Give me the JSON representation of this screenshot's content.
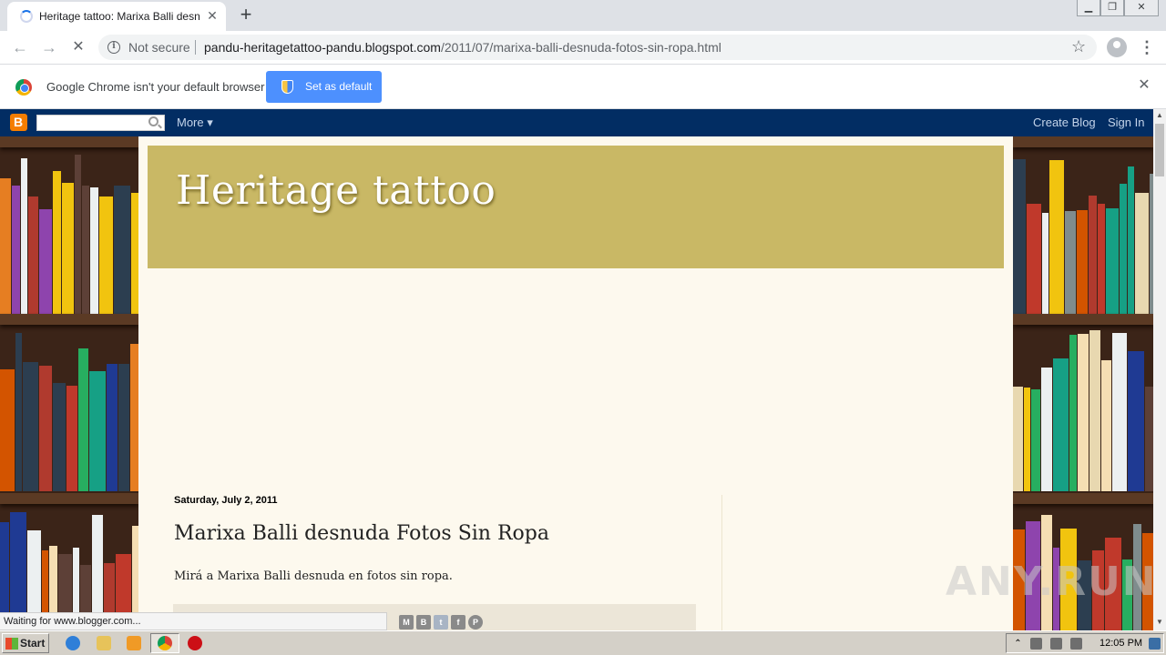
{
  "browser": {
    "tab": {
      "title": "Heritage tattoo: Marixa Balli desnuda Fotos Sin Ropa"
    },
    "new_tab_glyph": "+",
    "tab_close_glyph": "✕",
    "nav": {
      "back": "←",
      "forward": "→",
      "reload": "✕"
    },
    "address": {
      "security_label": "Not secure",
      "host": "pandu-heritagetattoo-pandu.blogspot.com",
      "path": "/2011/07/marixa-balli-desnuda-fotos-sin-ropa.html"
    },
    "star_glyph": "☆",
    "menu_glyph": "⋮",
    "infobar": {
      "message": "Google Chrome isn't your default browser",
      "button": "Set as default",
      "close_glyph": "✕"
    },
    "status_bubble": "Waiting for www.blogger.com..."
  },
  "blogger_bar": {
    "more_label": "More ▾",
    "create_blog": "Create Blog",
    "sign_in": "Sign In"
  },
  "blog": {
    "title": "Heritage tattoo",
    "post": {
      "date": "Saturday, July 2, 2011",
      "title": "Marixa Balli desnuda Fotos Sin Ropa",
      "body": "Mirá a Marixa Balli desnuda en fotos sin ropa."
    },
    "share_buttons": [
      {
        "icon": "email-icon",
        "glyph": "M"
      },
      {
        "icon": "blogthis-icon",
        "glyph": "B"
      },
      {
        "icon": "twitter-icon",
        "glyph": "t"
      },
      {
        "icon": "facebook-icon",
        "glyph": "f"
      },
      {
        "icon": "pinterest-icon",
        "glyph": "P"
      }
    ]
  },
  "watermark": "ANY.RUN",
  "taskbar": {
    "start_label": "Start",
    "clock": "12:05 PM"
  },
  "colors": {
    "blogger_bar": "#022d63",
    "header": "#c9b865",
    "content_bg": "#fdf9ee",
    "accent_button": "#4d90fe"
  }
}
